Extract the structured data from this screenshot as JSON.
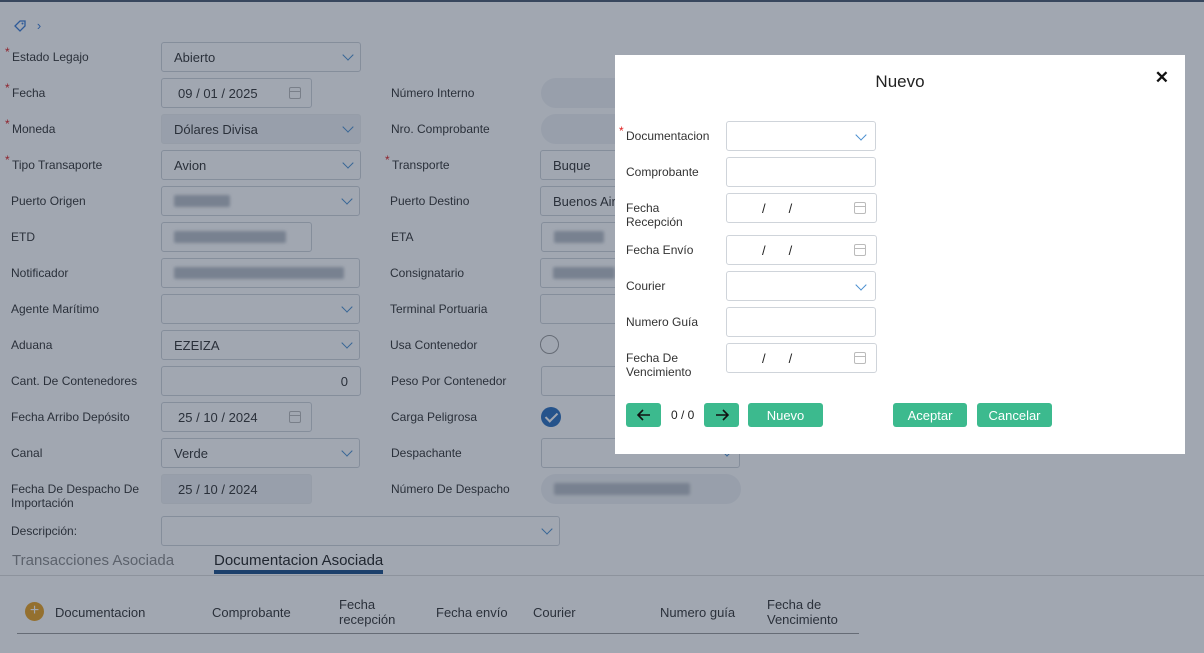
{
  "form": {
    "estado_legajo_label": "Estado Legajo",
    "estado_legajo_value": "Abierto",
    "fecha_label": "Fecha",
    "fecha_day": "09",
    "fecha_month": "01",
    "fecha_year": "2025",
    "numero_interno_label": "Número Interno",
    "moneda_label": "Moneda",
    "moneda_value": "Dólares Divisa",
    "nro_comprobante_label": "Nro. Comprobante",
    "tipo_transporte_label": "Tipo Transaporte",
    "tipo_transporte_value": "Avion",
    "transporte_label": "Transporte",
    "transporte_value": "Buque",
    "puerto_origen_label": "Puerto Origen",
    "puerto_destino_label": "Puerto Destino",
    "puerto_destino_value": "Buenos Air",
    "etd_label": "ETD",
    "eta_label": "ETA",
    "notificador_label": "Notificador",
    "consignatario_label": "Consignatario",
    "agente_label": "Agente Marítimo",
    "terminal_label": "Terminal Portuaria",
    "aduana_label": "Aduana",
    "aduana_value": "EZEIZA",
    "usa_contenedor_label": "Usa Contenedor",
    "cant_contenedores_label": "Cant. De Contenedores",
    "cant_contenedores_value": "0",
    "peso_label": "Peso Por Contenedor",
    "fecha_arribo_label": "Fecha Arribo Depósito",
    "fecha_arribo_day": "25",
    "fecha_arribo_month": "10",
    "fecha_arribo_year": "2024",
    "carga_peligrosa_label": "Carga Peligrosa",
    "canal_label": "Canal",
    "canal_value": "Verde",
    "despachante_label": "Despachante",
    "fecha_despacho_label_1": "Fecha De Despacho De",
    "fecha_despacho_label_2": "Importación",
    "fecha_despacho_day": "25",
    "fecha_despacho_month": "10",
    "fecha_despacho_year": "2024",
    "numero_despacho_label": "Número De Despacho",
    "descripcion_label": "Descripción:"
  },
  "tabs": {
    "transacciones": "Transacciones Asociada",
    "documentacion": "Documentacion Asociada"
  },
  "table": {
    "headers": [
      "Documentacion",
      "Comprobante",
      "Fecha",
      "recepción",
      "Fecha envío",
      "Courier",
      "Numero guía",
      "Fecha de",
      "Vencimiento"
    ]
  },
  "modal": {
    "title": "Nuevo",
    "documentacion_label": "Documentacion",
    "comprobante_label": "Comprobante",
    "fecha_recepcion_label_1": "Fecha",
    "fecha_recepcion_label_2": "Recepción",
    "fecha_envio_label": "Fecha Envío",
    "courier_label": "Courier",
    "numero_guia_label": "Numero Guía",
    "fecha_venc_label_1": "Fecha De",
    "fecha_venc_label_2": "Vencimiento",
    "date_sep": "/",
    "counter": "0 / 0",
    "nuevo_button": "Nuevo",
    "aceptar_button": "Aceptar",
    "cancelar_button": "Cancelar"
  },
  "colors": {
    "accent_green": "#3cba8e",
    "tab_active": "#1a4f88",
    "required": "#e02020"
  }
}
